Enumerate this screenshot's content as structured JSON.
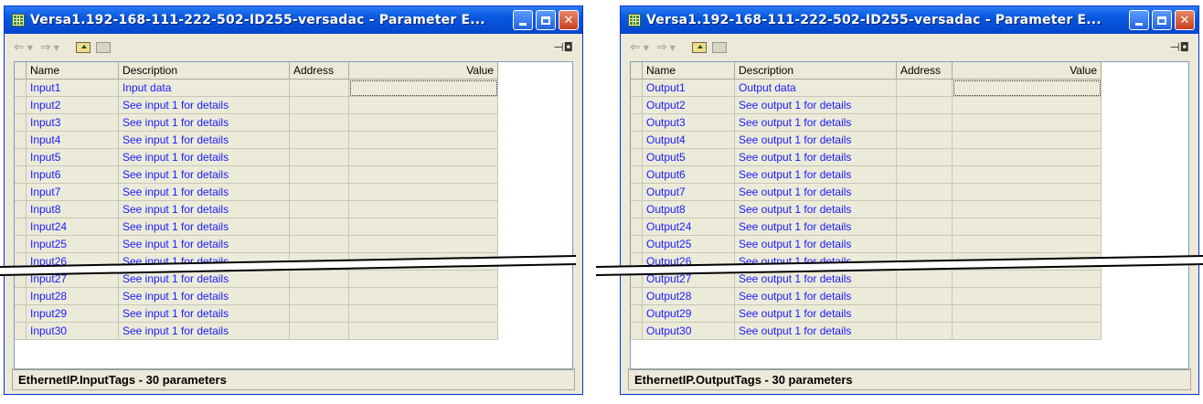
{
  "left_window": {
    "title": "Versa1.192-168-111-222-502-ID255-versadac - Parameter E...",
    "columns": [
      "Name",
      "Description",
      "Address",
      "Value"
    ],
    "rows": [
      {
        "name": "Input1",
        "desc": "Input data"
      },
      {
        "name": "Input2",
        "desc": "See input 1 for details"
      },
      {
        "name": "Input3",
        "desc": "See input 1 for details"
      },
      {
        "name": "Input4",
        "desc": "See input 1 for details"
      },
      {
        "name": "Input5",
        "desc": "See input 1 for details"
      },
      {
        "name": "Input6",
        "desc": "See input 1 for details"
      },
      {
        "name": "Input7",
        "desc": "See input 1 for details"
      },
      {
        "name": "Input8",
        "desc": "See input 1 for details"
      },
      {
        "name": "Input24",
        "desc": "See input 1 for details"
      },
      {
        "name": "Input25",
        "desc": "See input 1 for details"
      },
      {
        "name": "Input26",
        "desc": "See input 1 for details"
      },
      {
        "name": "Input27",
        "desc": "See input 1 for details"
      },
      {
        "name": "Input28",
        "desc": "See input 1 for details"
      },
      {
        "name": "Input29",
        "desc": "See input 1 for details"
      },
      {
        "name": "Input30",
        "desc": "See input 1 for details"
      }
    ],
    "status": "EthernetIP.InputTags  -  30 parameters"
  },
  "right_window": {
    "title": "Versa1.192-168-111-222-502-ID255-versadac - Parameter E...",
    "columns": [
      "Name",
      "Description",
      "Address",
      "Value"
    ],
    "rows": [
      {
        "name": "Output1",
        "desc": "Output data"
      },
      {
        "name": "Output2",
        "desc": "See output 1 for details"
      },
      {
        "name": "Output3",
        "desc": "See output 1 for details"
      },
      {
        "name": "Output4",
        "desc": "See output 1 for details"
      },
      {
        "name": "Output5",
        "desc": "See output 1 for details"
      },
      {
        "name": "Output6",
        "desc": "See output 1 for details"
      },
      {
        "name": "Output7",
        "desc": "See output 1 for details"
      },
      {
        "name": "Output8",
        "desc": "See output 1 for details"
      },
      {
        "name": "Output24",
        "desc": "See output 1 for details"
      },
      {
        "name": "Output25",
        "desc": "See output 1 for details"
      },
      {
        "name": "Output26",
        "desc": "See output 1 for details"
      },
      {
        "name": "Output27",
        "desc": "See output 1 for details"
      },
      {
        "name": "Output28",
        "desc": "See output 1 for details"
      },
      {
        "name": "Output29",
        "desc": "See output 1 for details"
      },
      {
        "name": "Output30",
        "desc": "See output 1 for details"
      }
    ],
    "status": "EthernetIP.OutputTags  -  30 parameters"
  },
  "icons": {
    "back": "back-arrow-icon",
    "forward": "forward-arrow-icon",
    "up_folder": "folder-up-icon",
    "folder": "folder-icon",
    "pin": "pin-icon",
    "app": "grid-icon"
  },
  "colors": {
    "titlebar": "#0858e0",
    "link_text": "#1a1aff",
    "row_bg": "#ecebd9"
  }
}
